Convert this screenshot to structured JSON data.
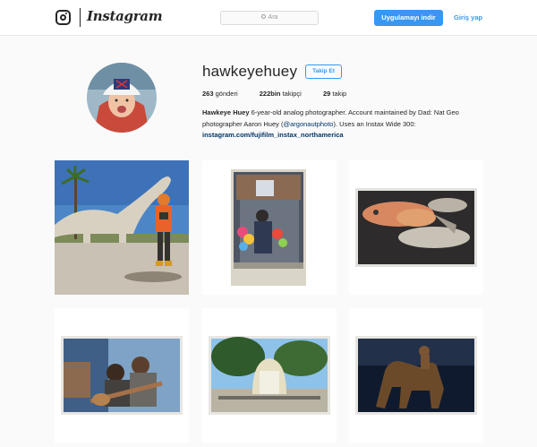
{
  "header": {
    "brand": "Instagram",
    "search_placeholder": "Ara",
    "install_button": "Uygulamayı indir",
    "login_link": "Giriş yap"
  },
  "profile": {
    "username": "hawkeyehuey",
    "follow_button": "Takip Et",
    "stats": [
      {
        "value": "263",
        "label": "gönderi"
      },
      {
        "value": "222bin",
        "label": "takipçi"
      },
      {
        "value": "29",
        "label": "takip"
      }
    ],
    "bio": {
      "name": "Hawkeye Huey",
      "text_before_mention": "6-year-old analog photographer. Account maintained by Dad: Nat Geo photographer Aaron Huey (",
      "mention": "@argonautphoto",
      "text_after_mention": "). Uses an Instax Wide 300:",
      "url": "instagram.com/fujifilm_instax_northamerica"
    }
  },
  "posts": [
    {
      "subject": "child-with-camera-and-dinosaur-statue"
    },
    {
      "subject": "man-with-balloons-instax-print"
    },
    {
      "subject": "fish-instax-print"
    },
    {
      "subject": "two-men-with-guitar-instax-print"
    },
    {
      "subject": "tree-and-fountain-instax-print"
    },
    {
      "subject": "horse-statue-instax-print"
    }
  ],
  "colors": {
    "accent": "#3897f0",
    "background": "#fafafa",
    "link": "#003569"
  }
}
